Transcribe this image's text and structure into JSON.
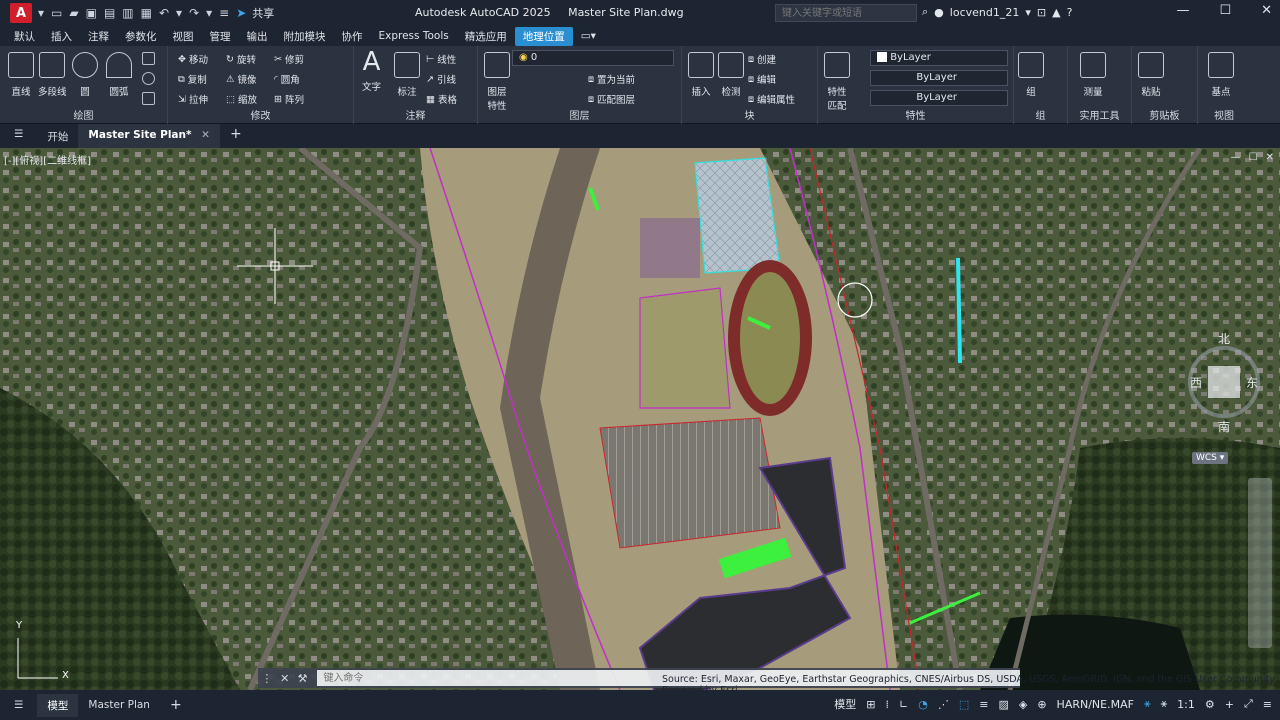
{
  "app": {
    "logo": "A",
    "title": "Autodesk AutoCAD 2025",
    "document": "Master Site Plan.dwg",
    "share_label": "共享",
    "search_placeholder": "键入关键字或短语",
    "user": "locvend1_21"
  },
  "menu": [
    "默认",
    "插入",
    "注释",
    "参数化",
    "视图",
    "管理",
    "输出",
    "附加模块",
    "协作",
    "Express Tools",
    "精选应用",
    "地理位置"
  ],
  "active_menu": "地理位置",
  "ribbon": {
    "draw": {
      "label": "绘图",
      "line": "直线",
      "polyline": "多段线",
      "circle": "圆",
      "arc": "圆弧"
    },
    "modify": {
      "label": "修改",
      "move": "移动",
      "rotate": "旋转",
      "trim": "修剪",
      "copy": "复制",
      "mirror": "镜像",
      "fillet": "圆角",
      "stretch": "拉伸",
      "scale": "缩放",
      "array": "阵列"
    },
    "annotation": {
      "label": "注释",
      "text": "文字",
      "dimension": "标注",
      "linear": "线性",
      "leader": "引线",
      "table": "表格"
    },
    "layers": {
      "label": "图层",
      "properties": "图层\n特性",
      "current_layer": "0",
      "make_current": "置为当前",
      "match_layer": "匹配图层"
    },
    "block": {
      "label": "块",
      "insert": "插入",
      "edit": "检测",
      "create": "创建",
      "edit_block": "编辑",
      "edit_attributes": "编辑属性"
    },
    "properties": {
      "label": "特性",
      "match": "特性\n匹配",
      "color": "ByLayer",
      "linetype": "ByLayer",
      "lineweight": "ByLayer"
    },
    "groups": {
      "label": "组",
      "group": "组"
    },
    "utilities": {
      "label": "实用工具",
      "measure": "测量"
    },
    "clipboard": {
      "label": "剪贴板",
      "paste": "粘贴"
    },
    "view": {
      "label": "视图",
      "base": "基点"
    }
  },
  "doc_tabs": {
    "start": "开始",
    "active": "Master Site Plan*"
  },
  "viewport": {
    "label": "[-][俯视][二维线框]",
    "compass": {
      "north": "北",
      "east": "东",
      "south": "南",
      "west": "西"
    },
    "wcs": "WCS",
    "ucs_y": "Y",
    "ucs_x": "X"
  },
  "command": {
    "placeholder": "键入命令"
  },
  "attribution": "Source: Esri, Maxar, GeoEye, Earthstar Geographics, CNES/Airbus DS, USDA, USGS, AeroGRID, IGN, and the GIS User Community  Powered by Esri",
  "status": {
    "layout_tabs": [
      "模型",
      "Master Plan"
    ],
    "model_label": "模型",
    "coord_system": "HARN/NE.MAF",
    "scale": "1:1"
  }
}
